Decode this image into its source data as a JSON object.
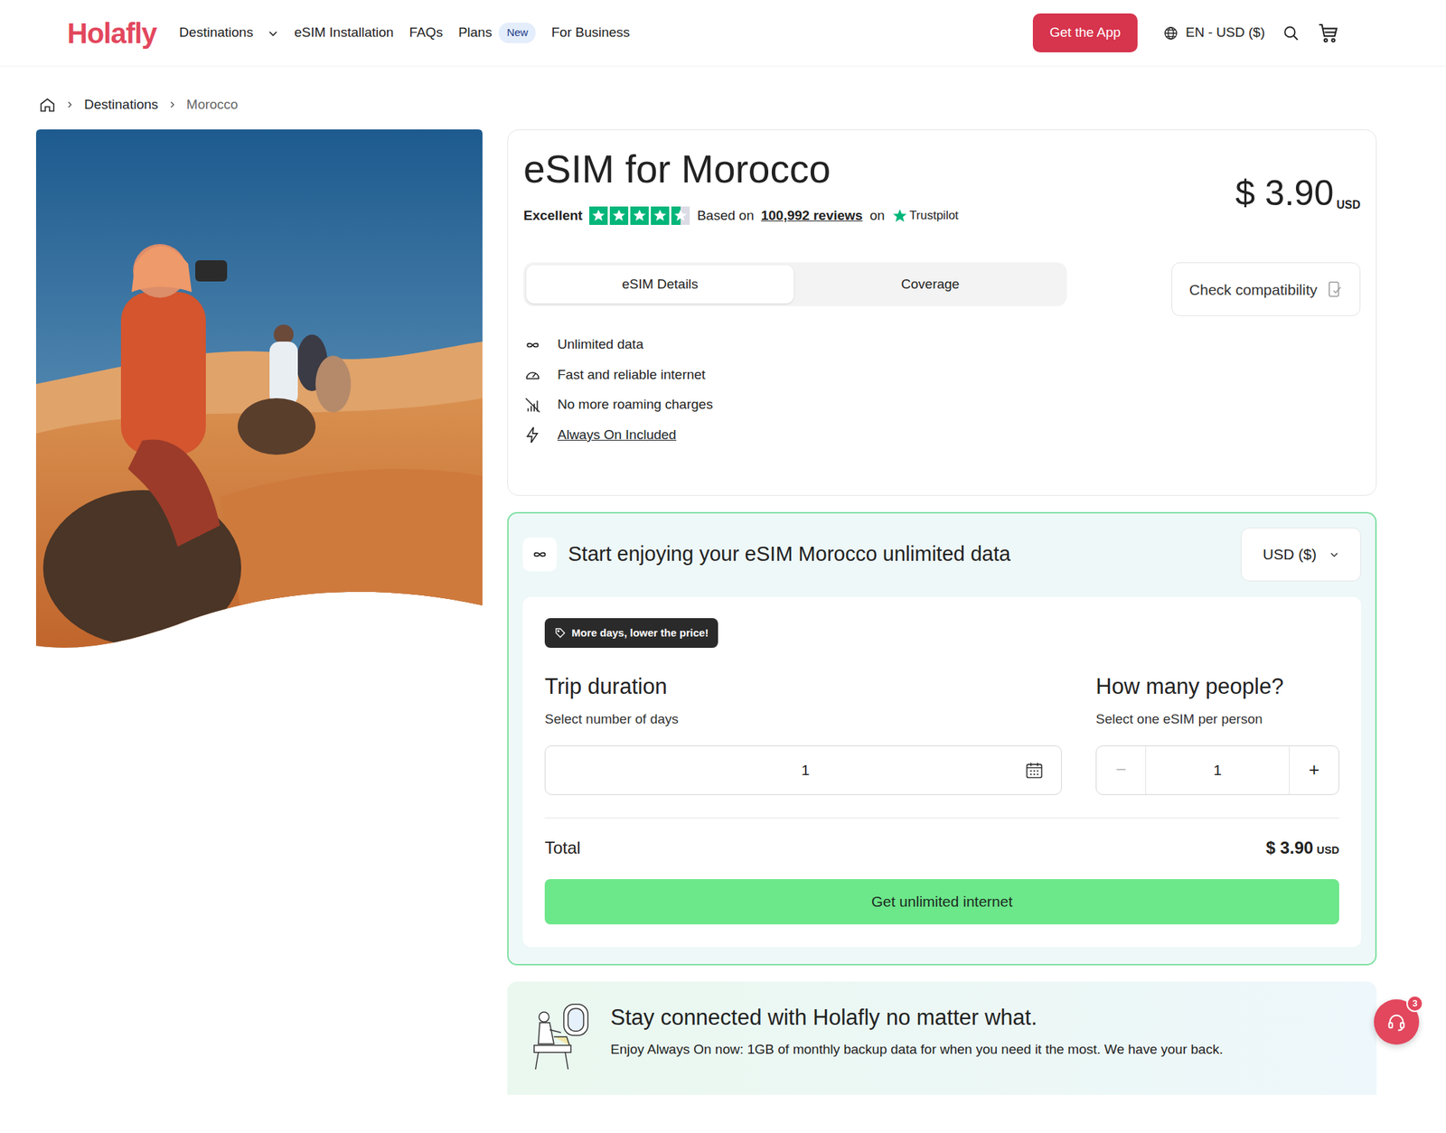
{
  "header": {
    "logo": "Holafly",
    "nav": [
      {
        "label": "Destinations",
        "kind": "dropdown"
      },
      {
        "label": "eSIM Installation",
        "kind": "link"
      },
      {
        "label": "FAQs",
        "kind": "link"
      },
      {
        "label": "Plans",
        "kind": "link",
        "badge": "New"
      },
      {
        "label": "For Business",
        "kind": "link"
      }
    ],
    "app_button": "Get the App",
    "locale": "EN - USD ($)"
  },
  "breadcrumb": [
    {
      "label": "Destinations",
      "current": false
    },
    {
      "label": "Morocco",
      "current": true
    }
  ],
  "product": {
    "title": "eSIM for Morocco",
    "rating": {
      "label": "Excellent",
      "stars": 4.5,
      "based_on": "Based on",
      "reviews": "100,992 reviews",
      "on": "on",
      "provider": "Trustpilot"
    },
    "price": {
      "amount": "$ 3.90",
      "currency": "USD"
    },
    "tabs": [
      {
        "label": "eSIM Details",
        "selected": true
      },
      {
        "label": "Coverage",
        "selected": false
      }
    ],
    "compatibility_button": "Check compatibility",
    "features": [
      {
        "label": "Unlimited data",
        "kind": "text"
      },
      {
        "label": "Fast and reliable internet",
        "kind": "text"
      },
      {
        "label": "No more roaming charges",
        "kind": "text"
      },
      {
        "label": "Always On Included",
        "kind": "link"
      }
    ]
  },
  "purchase": {
    "title": "Start enjoying your eSIM Morocco unlimited data",
    "currency": "USD ($)",
    "badge": "More days, lower the price!",
    "duration": {
      "title": "Trip duration",
      "hint": "Select number of days",
      "value": "1"
    },
    "people": {
      "title": "How many people?",
      "hint": "Select one eSIM per person",
      "value": "1",
      "decrement": {
        "label": "−",
        "disabled": true
      },
      "increment": {
        "label": "+",
        "disabled": false
      }
    },
    "total": {
      "label": "Total",
      "amount": "$ 3.90",
      "currency": "USD"
    },
    "button": "Get unlimited internet"
  },
  "banner": {
    "title": "Stay connected with Holafly no matter what.",
    "text": "Enjoy Always On now: 1GB of monthly backup data for when you need it the most. We have your back."
  },
  "chat": {
    "badge": "3"
  }
}
